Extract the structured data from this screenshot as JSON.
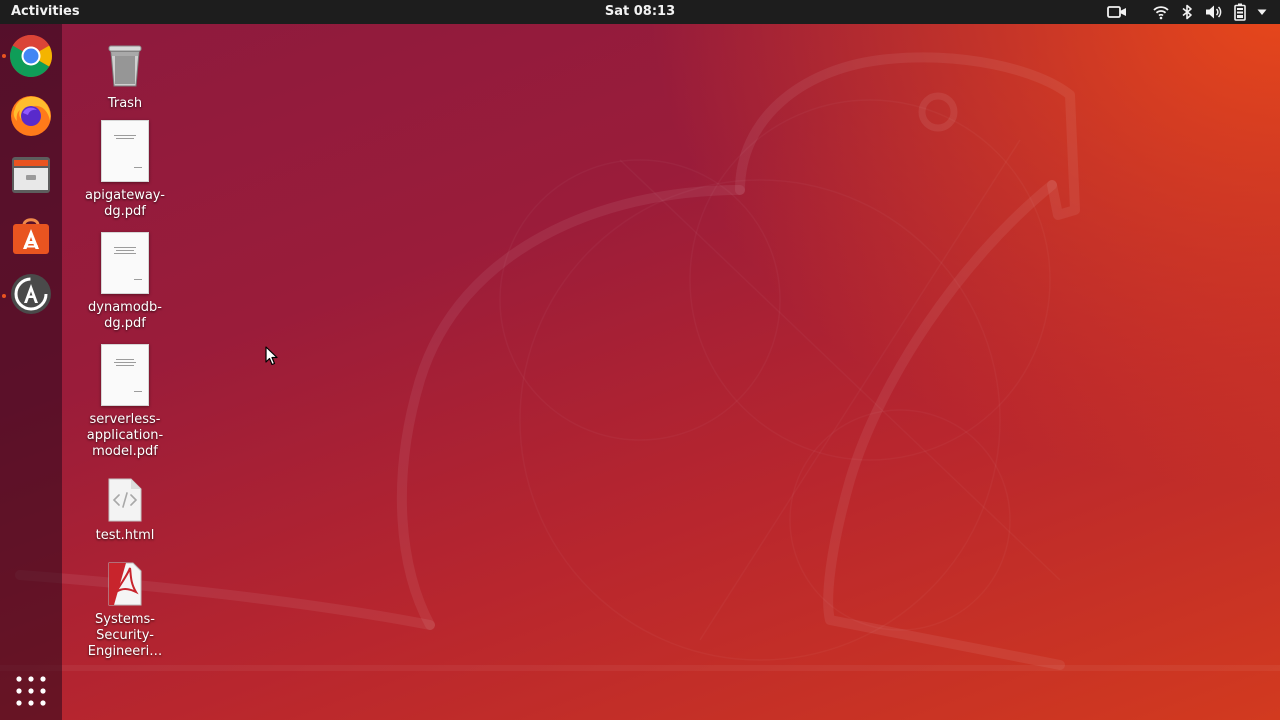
{
  "top_bar": {
    "activities_label": "Activities",
    "clock": "Sat 08:13",
    "tray_icons": [
      "screen-recording-icon",
      "wifi-icon",
      "bluetooth-icon",
      "volume-icon",
      "battery-icon",
      "system-menu-arrow-icon"
    ]
  },
  "dock": {
    "items": [
      {
        "name": "Google Chrome",
        "icon": "chrome-icon",
        "running": true
      },
      {
        "name": "Firefox",
        "icon": "firefox-icon",
        "running": false
      },
      {
        "name": "Files",
        "icon": "files-icon",
        "running": false
      },
      {
        "name": "Ubuntu Software",
        "icon": "software-center-icon",
        "running": false
      },
      {
        "name": "Software Updater",
        "icon": "software-updater-icon",
        "running": true
      }
    ],
    "show_apps_icon": "app-grid-icon"
  },
  "desktop": {
    "icons": [
      {
        "label": "Trash",
        "icon": "trash-icon"
      },
      {
        "label": "apigateway-dg.pdf",
        "icon": "pdf-document-icon"
      },
      {
        "label": "dynamodb-dg.pdf",
        "icon": "pdf-document-icon"
      },
      {
        "label": "serverless-application-model.pdf",
        "icon": "pdf-document-icon"
      },
      {
        "label": "test.html",
        "icon": "html-file-icon"
      },
      {
        "label": "Systems-Security-Engineeri…",
        "icon": "pdf-reader-file-icon"
      }
    ]
  },
  "colors": {
    "top_bar": "#1d1d1d",
    "accent": "#e95420",
    "wallpaper_dark": "#8c1a3e",
    "wallpaper_light": "#e8481a"
  }
}
